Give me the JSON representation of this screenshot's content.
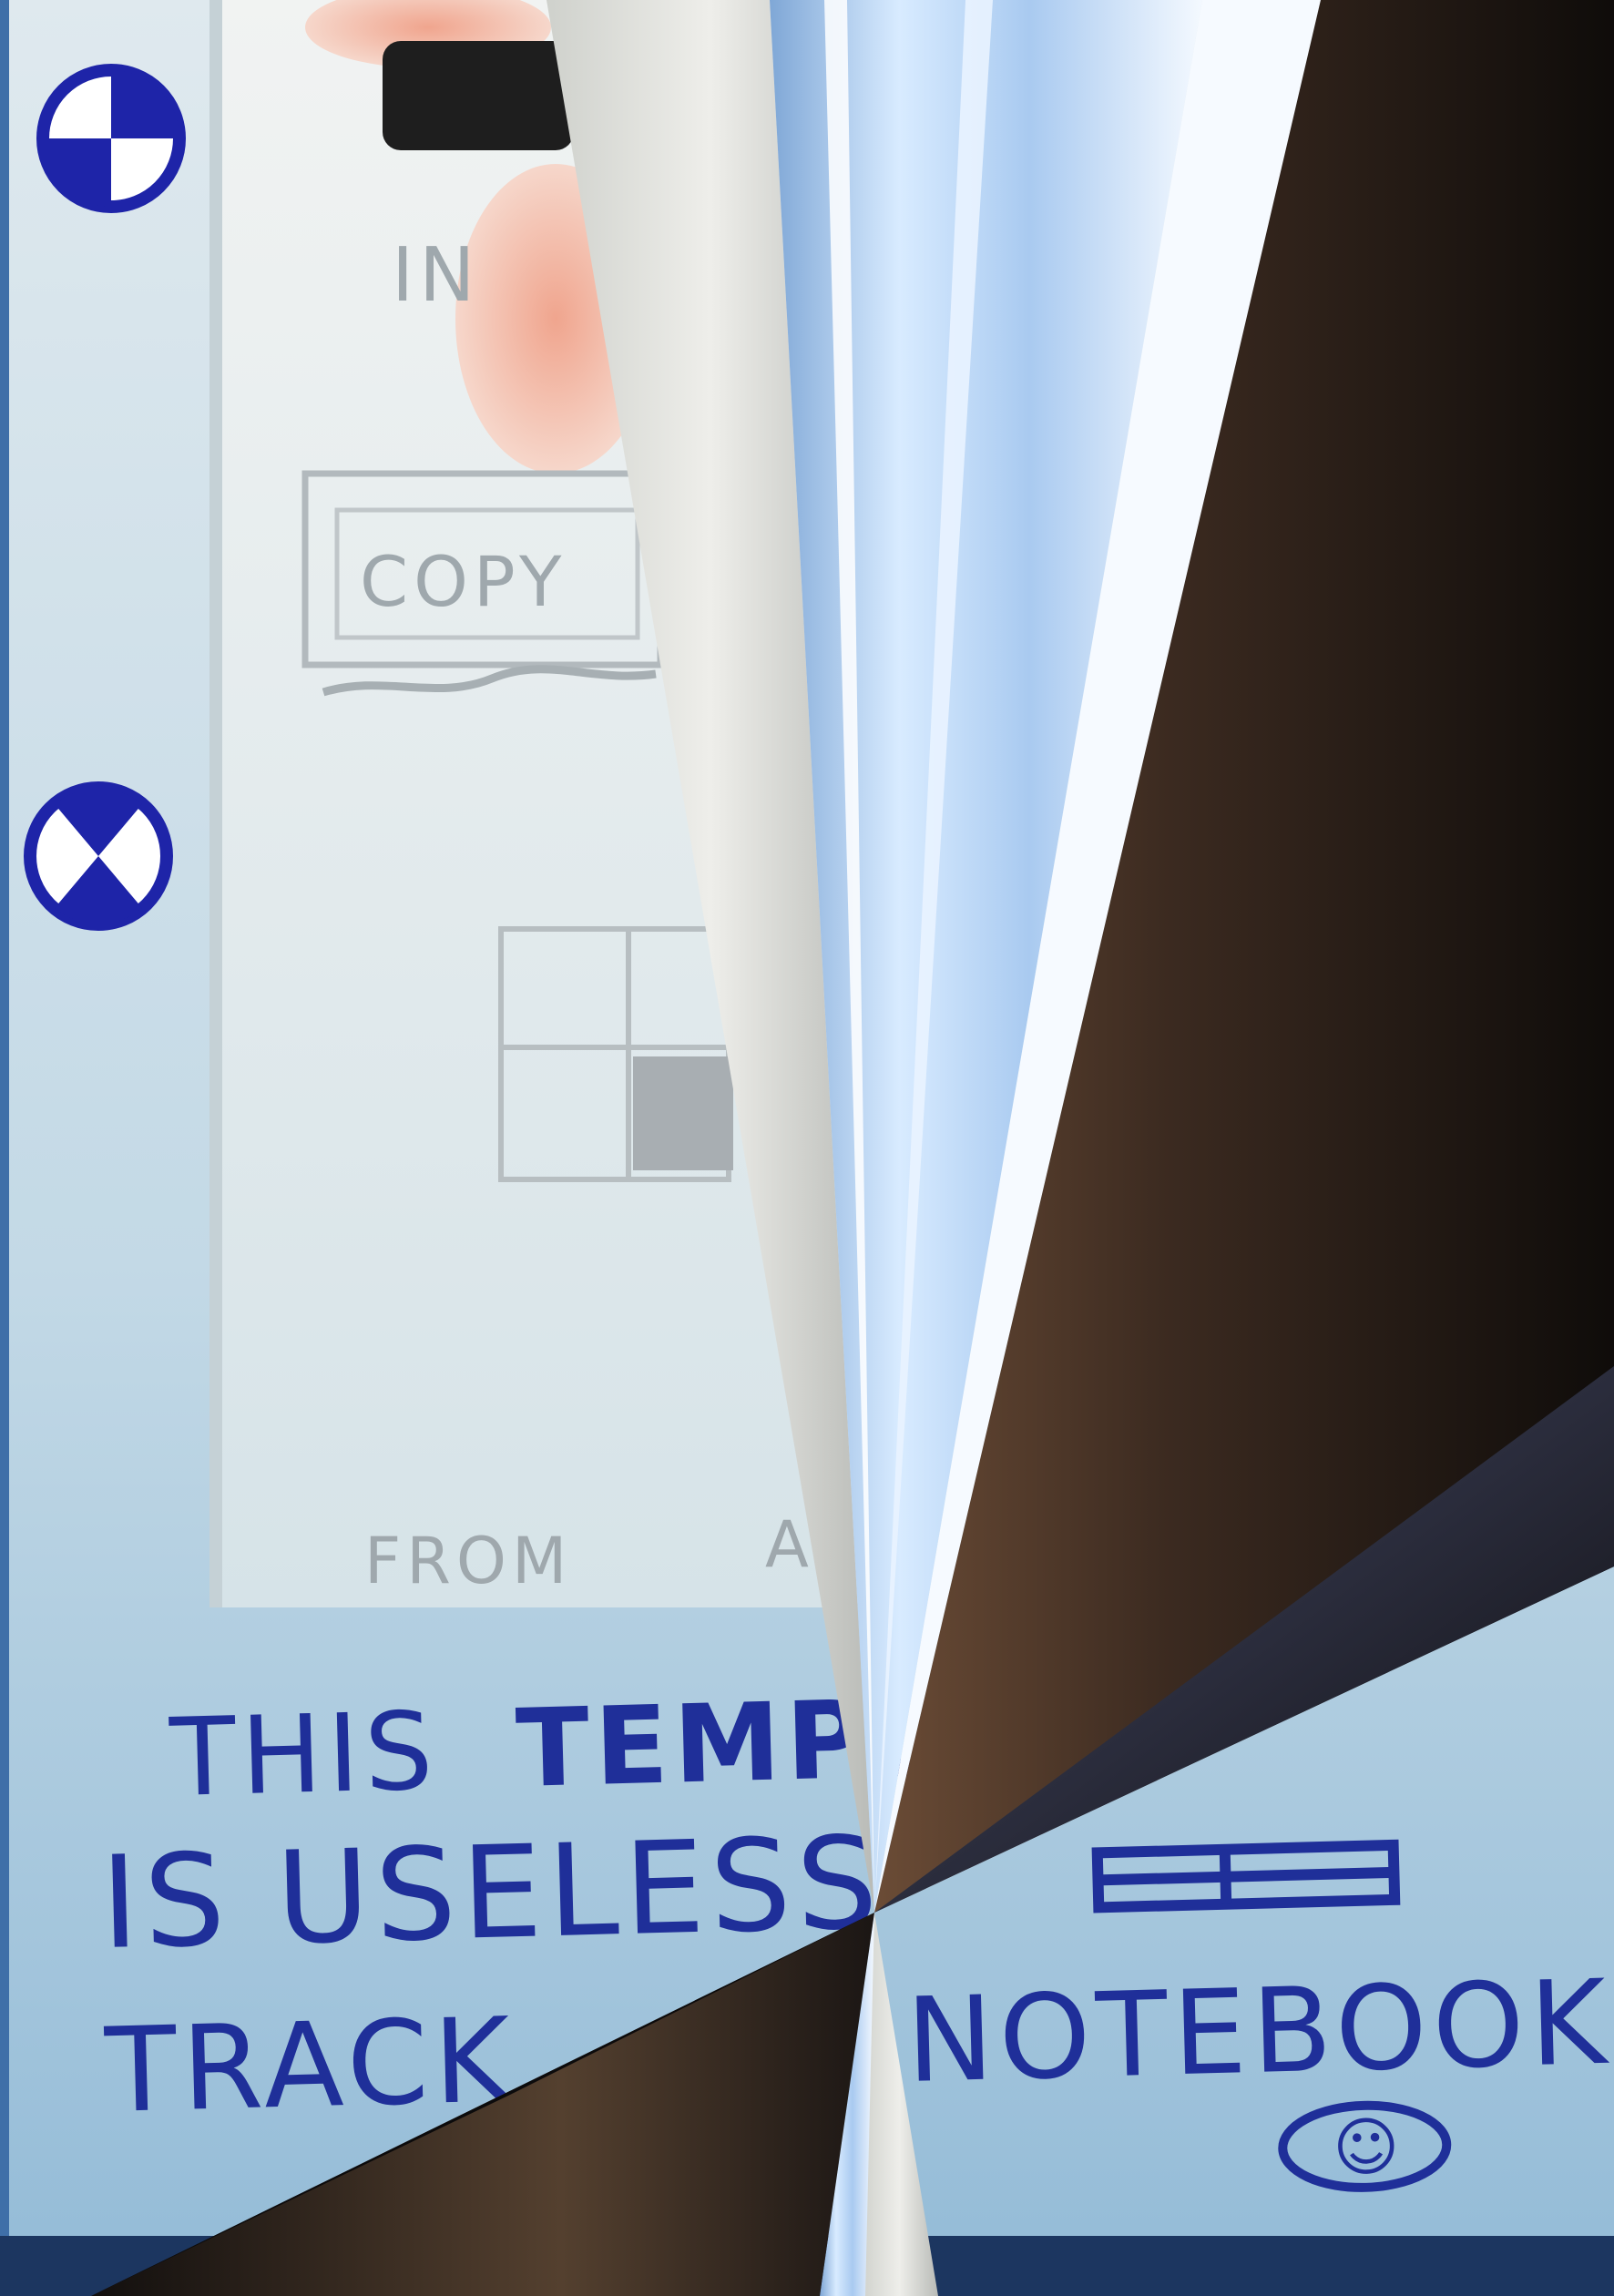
{
  "top_card": {
    "title_fragment": "IN",
    "box_label": "COPY",
    "footer_fragment": "FROM",
    "footer_tail": "A"
  },
  "note": {
    "line1_a": "THIS",
    "line1_b": "TEMPL",
    "line2": "IS USELESS",
    "line3_a": "TRACK",
    "line3_b": "NOTEBOOK",
    "doodle": "☺"
  },
  "colors": {
    "ink": "#1f2f99",
    "background": "#b9d3e3",
    "card": "#eaf0f2"
  }
}
